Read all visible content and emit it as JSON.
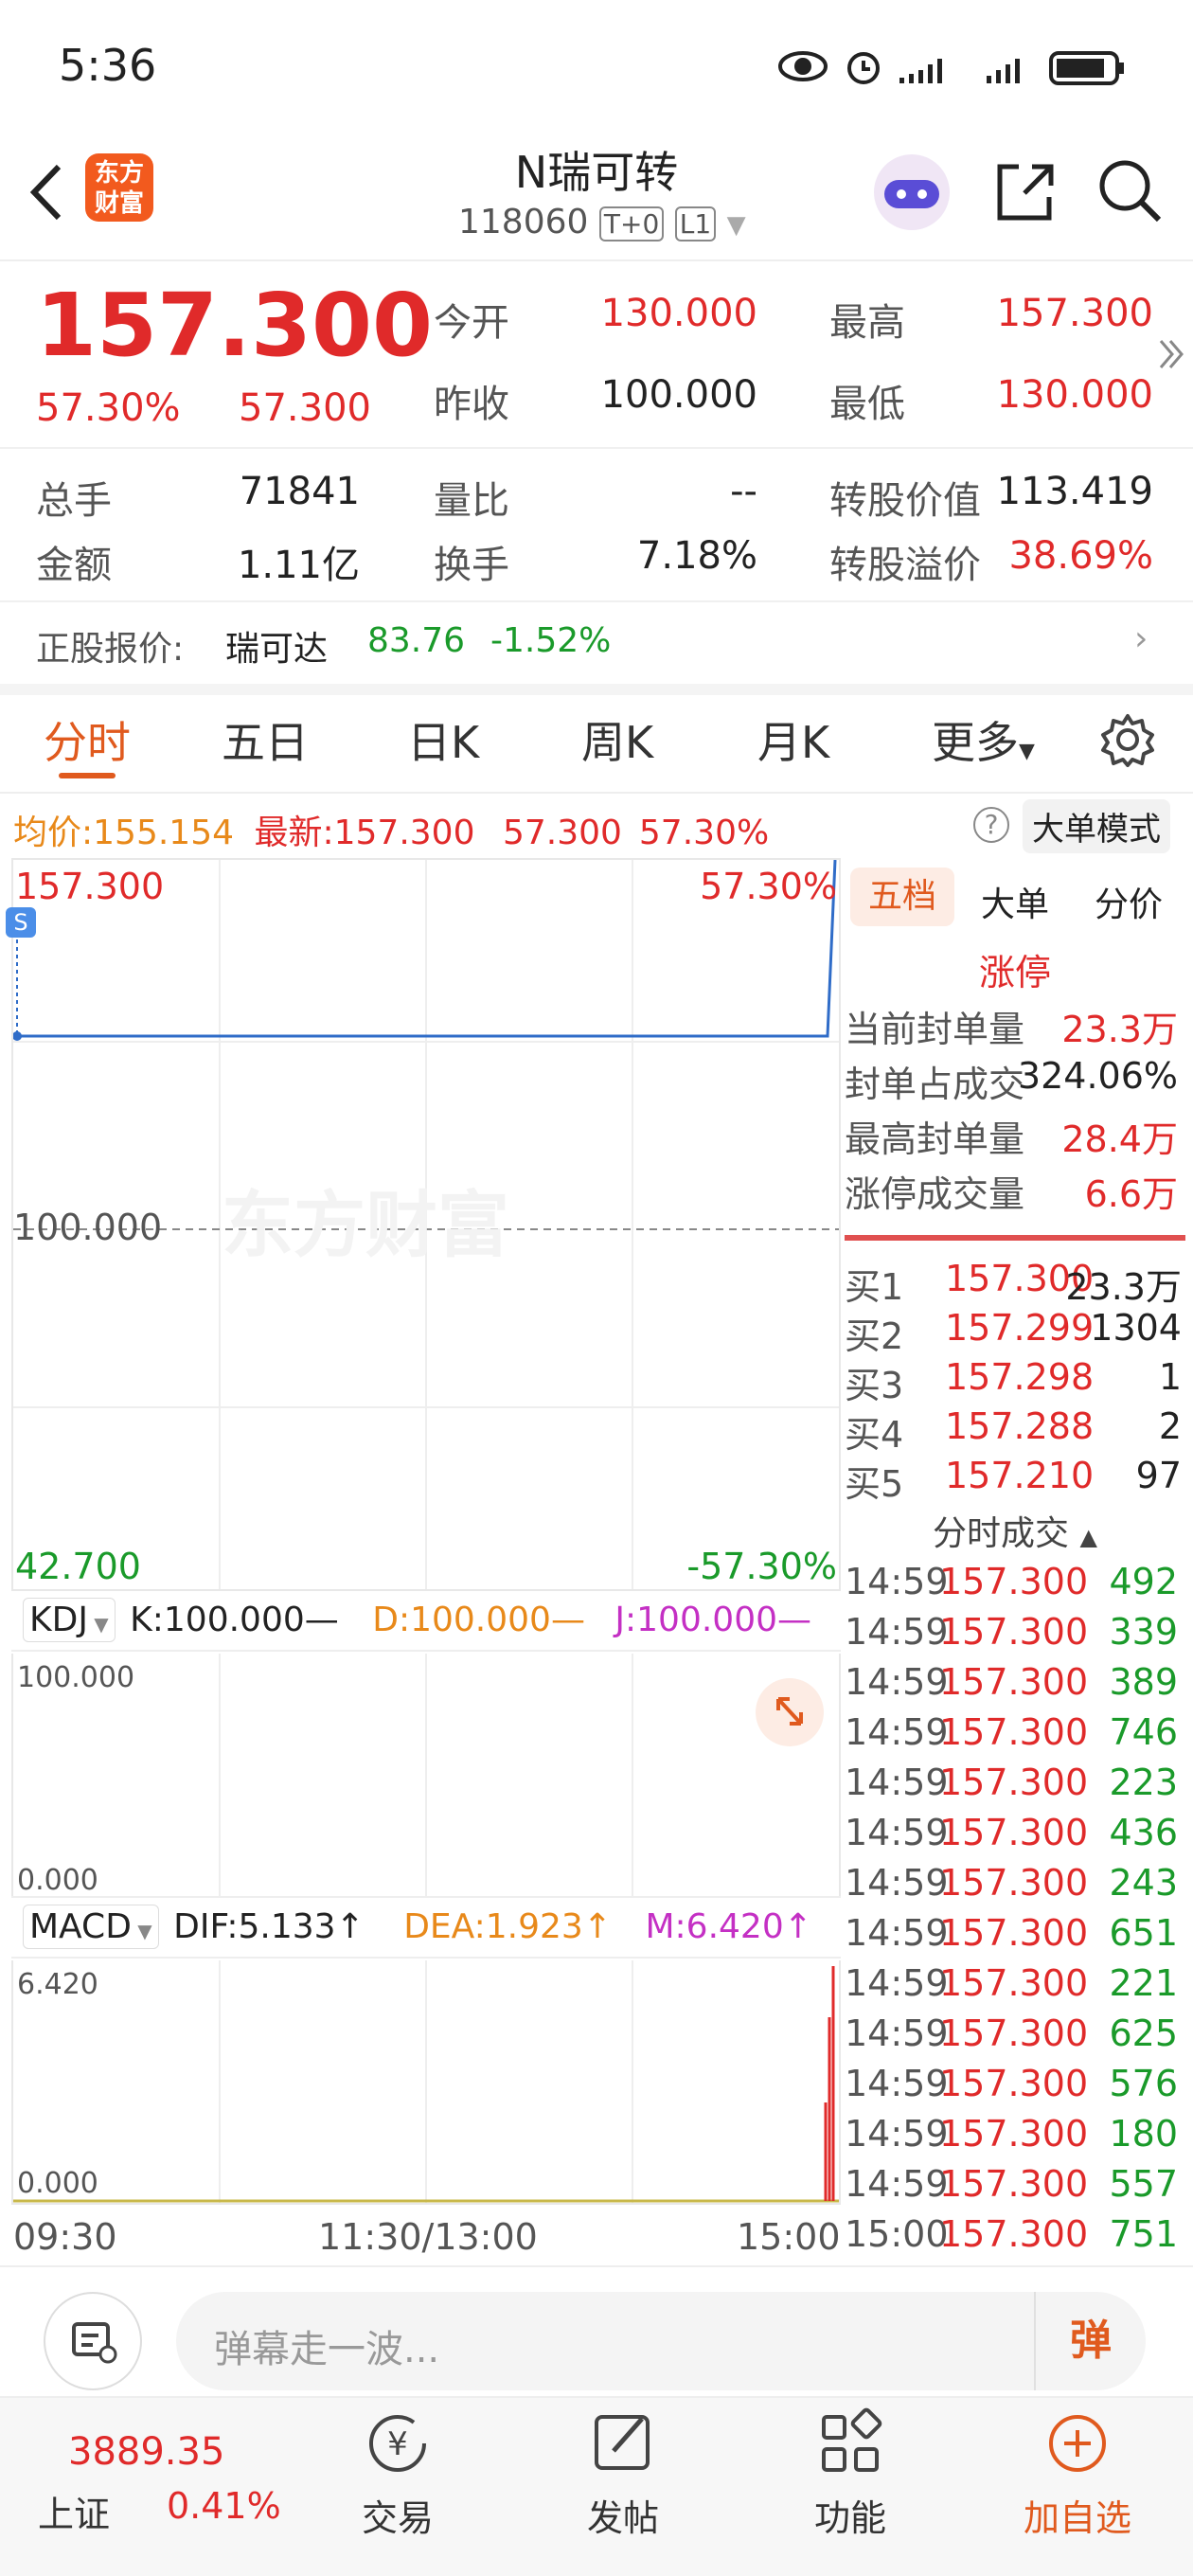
{
  "status": {
    "time": "5:36"
  },
  "header": {
    "title": "N瑞可转",
    "code": "118060",
    "badge1": "T+0",
    "badge2": "L1",
    "logo_line1": "东方",
    "logo_line2": "财富"
  },
  "quote": {
    "price": "157.300",
    "pct": "57.30%",
    "chg": "57.300",
    "open_label": "今开",
    "open": "130.000",
    "high_label": "最高",
    "high": "157.300",
    "prev_label": "昨收",
    "prev": "100.000",
    "low_label": "最低",
    "low": "130.000",
    "vol_label": "总手",
    "vol": "71841",
    "lb_label": "量比",
    "lb": "--",
    "cv_label": "转股价值",
    "cv": "113.419",
    "amt_label": "金额",
    "amt": "1.11亿",
    "turn_label": "换手",
    "turn": "7.18%",
    "prem_label": "转股溢价",
    "prem": "38.69%"
  },
  "underlying": {
    "label": "正股报价:",
    "name": "瑞可达",
    "price": "83.76",
    "pct": "-1.52%"
  },
  "tabs": [
    "分时",
    "五日",
    "日K",
    "周K",
    "月K",
    "更多"
  ],
  "infoline": {
    "avg_label": "均价:",
    "avg": "155.154",
    "latest_label": "最新:",
    "latest": "157.300",
    "chg": "57.300",
    "pct": "57.30%",
    "mode": "大单模式"
  },
  "chart": {
    "top_price": "157.300",
    "top_pct": "57.30%",
    "mid_price": "100.000",
    "bot_price": "42.700",
    "bot_pct": "-57.30%",
    "watermark": "东方财富",
    "times": [
      "09:30",
      "11:30/13:00",
      "15:00"
    ]
  },
  "kdj": {
    "name": "KDJ",
    "k": "K:100.000—",
    "d": "D:100.000—",
    "j": "J:100.000—",
    "top": "100.000",
    "bot": "0.000"
  },
  "macd": {
    "name": "MACD",
    "dif": "DIF:5.133↑",
    "dea": "DEA:1.923↑",
    "m": "M:6.420↑",
    "top": "6.420",
    "bot": "0.000"
  },
  "side": {
    "tabs": [
      "五档",
      "大单",
      "分价"
    ],
    "limit_label": "涨停",
    "seal": [
      {
        "label": "当前封单量",
        "value": "23.3万"
      },
      {
        "label": "封单占成交",
        "value": "324.06%"
      },
      {
        "label": "最高封单量",
        "value": "28.4万"
      },
      {
        "label": "涨停成交量",
        "value": "6.6万"
      }
    ],
    "book": [
      {
        "label": "买1",
        "price": "157.300",
        "vol": "23.3万"
      },
      {
        "label": "买2",
        "price": "157.299",
        "vol": "1304"
      },
      {
        "label": "买3",
        "price": "157.298",
        "vol": "1"
      },
      {
        "label": "买4",
        "price": "157.288",
        "vol": "2"
      },
      {
        "label": "买5",
        "price": "157.210",
        "vol": "97"
      }
    ],
    "trades_title": "分时成交",
    "trades": [
      {
        "t": "14:59",
        "p": "157.300",
        "v": "492"
      },
      {
        "t": "14:59",
        "p": "157.300",
        "v": "339"
      },
      {
        "t": "14:59",
        "p": "157.300",
        "v": "389"
      },
      {
        "t": "14:59",
        "p": "157.300",
        "v": "746"
      },
      {
        "t": "14:59",
        "p": "157.300",
        "v": "223"
      },
      {
        "t": "14:59",
        "p": "157.300",
        "v": "436"
      },
      {
        "t": "14:59",
        "p": "157.300",
        "v": "243"
      },
      {
        "t": "14:59",
        "p": "157.300",
        "v": "651"
      },
      {
        "t": "14:59",
        "p": "157.300",
        "v": "221"
      },
      {
        "t": "14:59",
        "p": "157.300",
        "v": "625"
      },
      {
        "t": "14:59",
        "p": "157.300",
        "v": "576"
      },
      {
        "t": "14:59",
        "p": "157.300",
        "v": "180"
      },
      {
        "t": "14:59",
        "p": "157.300",
        "v": "557"
      },
      {
        "t": "15:00",
        "p": "157.300",
        "v": "751"
      }
    ]
  },
  "comment": {
    "placeholder": "弹幕走一波...",
    "btn": "弹"
  },
  "bottom": {
    "index_value": "3889.35",
    "index_name": "上证",
    "index_pct": "0.41%",
    "items": [
      "交易",
      "发帖",
      "功能",
      "加自选"
    ]
  }
}
